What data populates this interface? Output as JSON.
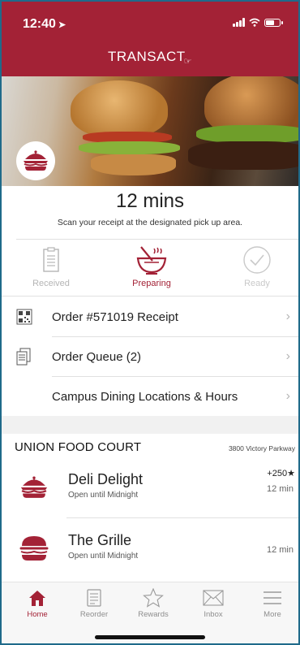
{
  "status_bar": {
    "time": "12:40"
  },
  "header": {
    "brand": "TRANSACT"
  },
  "order": {
    "wait_time": "12 mins",
    "instruction": "Scan your receipt at the designated pick up area.",
    "steps": [
      {
        "label": "Received",
        "state": "done",
        "icon": "receipt-icon"
      },
      {
        "label": "Preparing",
        "state": "active",
        "icon": "mixing-bowl-icon"
      },
      {
        "label": "Ready",
        "state": "pending",
        "icon": "check-circle-icon"
      }
    ]
  },
  "menu": {
    "receipt": "Order #571019 Receipt",
    "queue": "Order Queue (2)",
    "locations": "Campus Dining Locations & Hours"
  },
  "locations": {
    "title": "UNION FOOD COURT",
    "address": "3800 Victory Parkway",
    "items": [
      {
        "name": "Deli Delight",
        "hours": "Open until Midnight",
        "points": "+250★",
        "time": "12 min",
        "icon": "sandwich-icon"
      },
      {
        "name": "The Grille",
        "hours": "Open until Midnight",
        "points": "",
        "time": "12 min",
        "icon": "burger-icon"
      }
    ]
  },
  "tabs": [
    {
      "label": "Home",
      "icon": "home-icon",
      "active": true
    },
    {
      "label": "Reorder",
      "icon": "reorder-icon",
      "active": false
    },
    {
      "label": "Rewards",
      "icon": "star-icon",
      "active": false
    },
    {
      "label": "Inbox",
      "icon": "envelope-icon",
      "active": false
    },
    {
      "label": "More",
      "icon": "menu-icon",
      "active": false
    }
  ],
  "colors": {
    "brand": "#a32236",
    "muted": "#b5b5b5",
    "inactive_tab": "#8e8e8e"
  }
}
